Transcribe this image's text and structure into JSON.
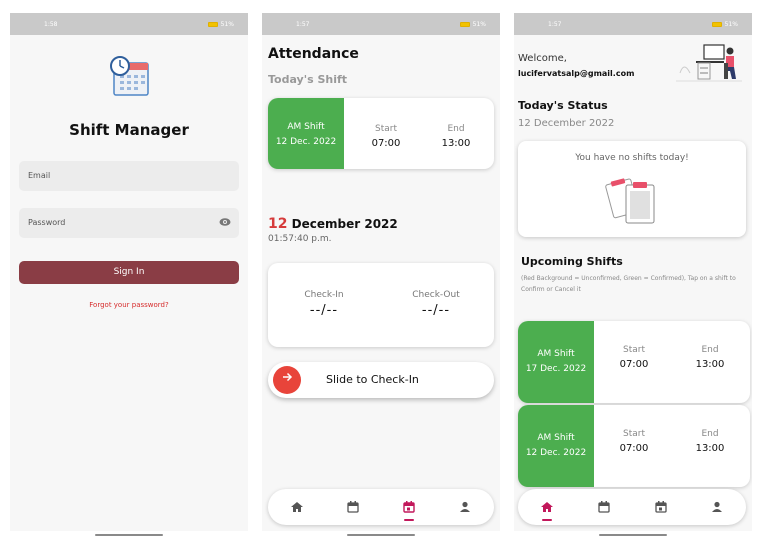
{
  "colors": {
    "green": "#4cae4f",
    "maroon": "#8a3d45",
    "accent_red": "#e8443a",
    "nav_active": "#c2185b"
  },
  "screen1": {
    "status": {
      "time": "1:58",
      "battery": "51%"
    },
    "title": "Shift Manager",
    "email_placeholder": "Email",
    "password_placeholder": "Password",
    "signin_label": "Sign In",
    "forgot_label": "Forgot your password?"
  },
  "screen2": {
    "status": {
      "time": "1:57",
      "battery": "51%"
    },
    "title": "Attendance",
    "subtitle": "Today's Shift",
    "shift": {
      "name": "AM Shift",
      "date": "12 Dec. 2022",
      "start_label": "Start",
      "start": "07:00",
      "end_label": "End",
      "end": "13:00"
    },
    "date_day": "12",
    "date_rest": " December 2022",
    "time": "01:57:40 p.m.",
    "checkin_label": "Check-In",
    "checkin_value": "--/--",
    "checkout_label": "Check-Out",
    "checkout_value": "--/--",
    "slide_label": "Slide to Check-In"
  },
  "screen3": {
    "status": {
      "time": "1:57",
      "battery": "51%"
    },
    "welcome": "Welcome,",
    "email": "lucifervatsalp@gmail.com",
    "status_title": "Today's Status",
    "status_date": "12 December 2022",
    "no_shift_msg": "You have no shifts today!",
    "upcoming_title": "Upcoming Shifts",
    "upcoming_note": "(Red Background = Unconfirmed, Green = Confirmed), Tap on a shift to Confirm or Cancel it",
    "shifts": [
      {
        "name": "AM Shift",
        "date": "17 Dec. 2022",
        "start_label": "Start",
        "start": "07:00",
        "end_label": "End",
        "end": "13:00"
      },
      {
        "name": "AM Shift",
        "date": "12 Dec. 2022",
        "start_label": "Start",
        "start": "07:00",
        "end_label": "End",
        "end": "13:00"
      }
    ]
  },
  "nav": {
    "icons": [
      "home-icon",
      "calendar-icon",
      "calendar-today-icon",
      "person-icon"
    ]
  }
}
